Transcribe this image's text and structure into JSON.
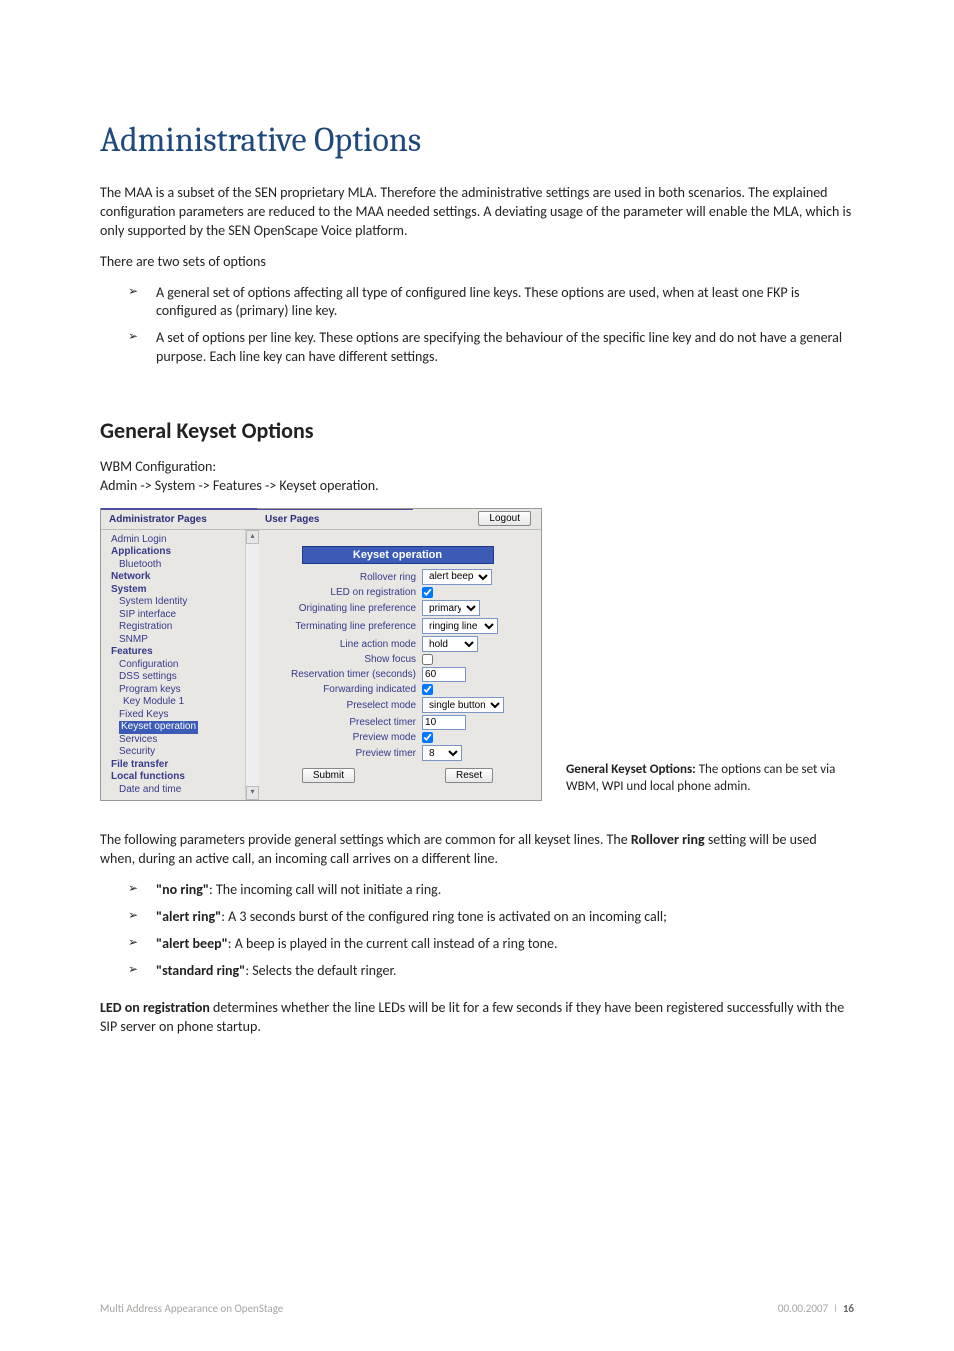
{
  "headings": {
    "h1": "Administrative Options",
    "h2": "General Keyset Options"
  },
  "paragraphs": {
    "intro": "The MAA is a subset of the SEN proprietary MLA. Therefore the administrative settings are used in both scenarios. The explained configuration parameters are reduced to the MAA needed settings. A deviating usage of the parameter will enable the MLA, which is only supported by the SEN OpenScape Voice platform.",
    "two_sets": "There are two sets of options",
    "two_bullets": [
      "A general set of options affecting all type of configured line keys. These options are used, when at least one FKP is configured as (primary) line key.",
      "A set of options per line key. These options are specifying the behaviour of the specific line key and do not have a general purpose. Each line key can have different settings."
    ],
    "wbm_label": "WBM Configuration:",
    "wbm_path": "Admin -> System -> Features -> Keyset operation.",
    "rollover_intro_a": "The following parameters provide general settings which are common for all keyset lines. The ",
    "rollover_bold": "Rollover ring",
    "rollover_intro_b": " setting will be used when, during an active call, an incoming call arrives on a different line.",
    "rollover_bullets": [
      {
        "term": "\"no ring\"",
        "desc": ": The incoming call will not initiate a ring."
      },
      {
        "term": "\"alert ring\"",
        "desc": ": A 3 seconds burst of the configured ring tone is activated on an incoming call;"
      },
      {
        "term": "\"alert beep\"",
        "desc": ": A beep is played in the current call instead of a ring tone."
      },
      {
        "term": "\"standard ring\"",
        "desc": ": Selects the default ringer."
      }
    ],
    "led_bold": "LED on registration",
    "led_desc": " determines whether the line LEDs will be lit for a few seconds if they have been registered successfully with the SIP server on phone startup."
  },
  "wbm": {
    "tabs": {
      "admin": "Administrator Pages",
      "user": "User Pages",
      "logout": "Logout"
    },
    "nav": [
      {
        "text": "Admin Login",
        "cls": ""
      },
      {
        "text": "Applications",
        "cls": "bold"
      },
      {
        "text": "Bluetooth",
        "cls": "indent1"
      },
      {
        "text": "Network",
        "cls": "bold"
      },
      {
        "text": "System",
        "cls": "bold"
      },
      {
        "text": "System Identity",
        "cls": "indent1"
      },
      {
        "text": "SIP interface",
        "cls": "indent1"
      },
      {
        "text": "Registration",
        "cls": "indent1"
      },
      {
        "text": "SNMP",
        "cls": "indent1"
      },
      {
        "text": "Features",
        "cls": "bold"
      },
      {
        "text": "Configuration",
        "cls": "indent1"
      },
      {
        "text": "DSS settings",
        "cls": "indent1"
      },
      {
        "text": "Program keys",
        "cls": "indent1"
      },
      {
        "text": "Key Module 1",
        "cls": "indent2"
      },
      {
        "text": "Fixed Keys",
        "cls": "indent1"
      },
      {
        "text": "Keyset operation",
        "cls": "indent1 sel"
      },
      {
        "text": "Services",
        "cls": "indent1"
      },
      {
        "text": "Security",
        "cls": "indent1"
      },
      {
        "text": "File transfer",
        "cls": "bold"
      },
      {
        "text": "Local functions",
        "cls": "bold"
      },
      {
        "text": "Date and time",
        "cls": "indent1"
      }
    ],
    "formTitle": "Keyset operation",
    "fields": {
      "rollover_ring": {
        "label": "Rollover ring",
        "value": "alert beep"
      },
      "led_on_registration": {
        "label": "LED on registration",
        "checked": true
      },
      "originating_line_pref": {
        "label": "Originating line preference",
        "value": "primary"
      },
      "terminating_line_pref": {
        "label": "Terminating line preference",
        "value": "ringing line"
      },
      "line_action_mode": {
        "label": "Line action mode",
        "value": "hold"
      },
      "show_focus": {
        "label": "Show focus",
        "checked": false
      },
      "reservation_timer": {
        "label": "Reservation timer (seconds)",
        "value": "60"
      },
      "forwarding_indicated": {
        "label": "Forwarding indicated",
        "checked": true
      },
      "preselect_mode": {
        "label": "Preselect mode",
        "value": "single button"
      },
      "preselect_timer": {
        "label": "Preselect timer",
        "value": "10"
      },
      "preview_mode": {
        "label": "Preview mode",
        "checked": true
      },
      "preview_timer": {
        "label": "Preview timer",
        "value": "8"
      }
    },
    "buttons": {
      "submit": "Submit",
      "reset": "Reset"
    }
  },
  "caption": {
    "title": "General Keyset Options:",
    "text": " The options can be set via WBM, WPI und local phone admin."
  },
  "footer": {
    "left": "Multi Address Appearance on OpenStage",
    "date": "00.00.2007",
    "page": "16"
  }
}
